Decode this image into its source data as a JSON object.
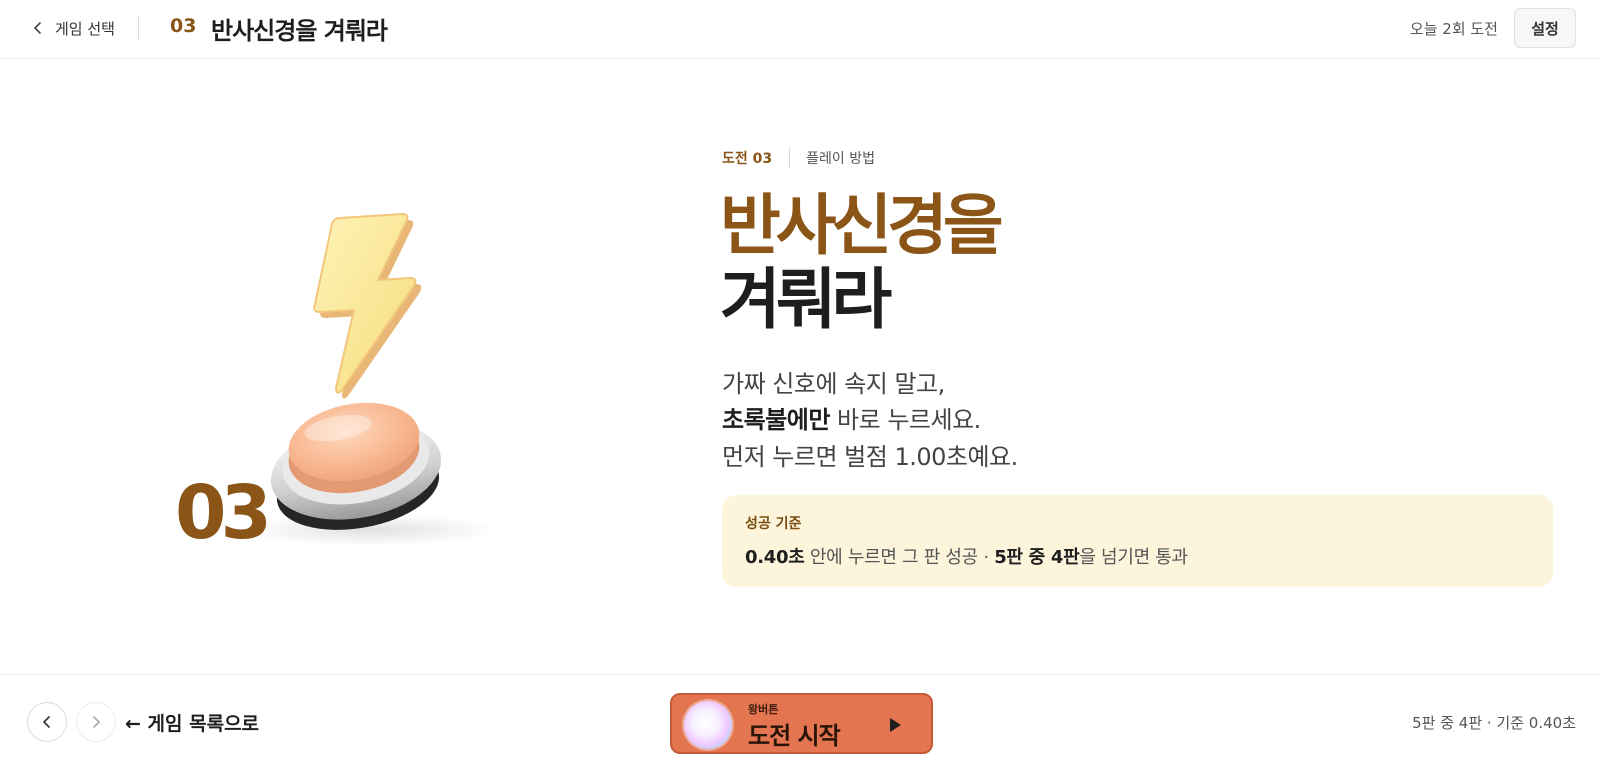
{
  "header": {
    "back_label": "게임 선택",
    "game_number": "03",
    "title": "반사신경을 겨뤄라",
    "attempts_today": "오늘 2회 도전",
    "settings_label": "설정"
  },
  "illustration": {
    "number": "03",
    "icons": [
      "lightning-icon",
      "push-button-icon"
    ]
  },
  "intro": {
    "challenge_tag": "도전 03",
    "how_to_play": "플레이 방법",
    "title_line1": "반사신경을",
    "title_line2": "겨뤄라",
    "desc_line1": "가짜 신호에 속지 말고,",
    "desc_line2_bold": "초록불에만",
    "desc_line2_rest": " 바로 누르세요.",
    "desc_line3": "먼저 누르면 벌점 1.00초예요."
  },
  "criteria": {
    "label": "성공 기준",
    "time_bold": "0.40초",
    "time_rest": " 안에 누르면 그 판 성공 · ",
    "rounds_bold": "5판 중 4판",
    "rounds_rest": "을 넘기면 통과"
  },
  "footer": {
    "back_to_list": "← 게임 목록으로",
    "start_sub": "왕버튼",
    "start_label": "도전 시작",
    "summary": "5판 중 4판 · 기준 0.40초"
  },
  "colors": {
    "accent_brown": "#8a5516",
    "start_button": "#e37551",
    "criteria_bg": "#fdf4dc"
  }
}
